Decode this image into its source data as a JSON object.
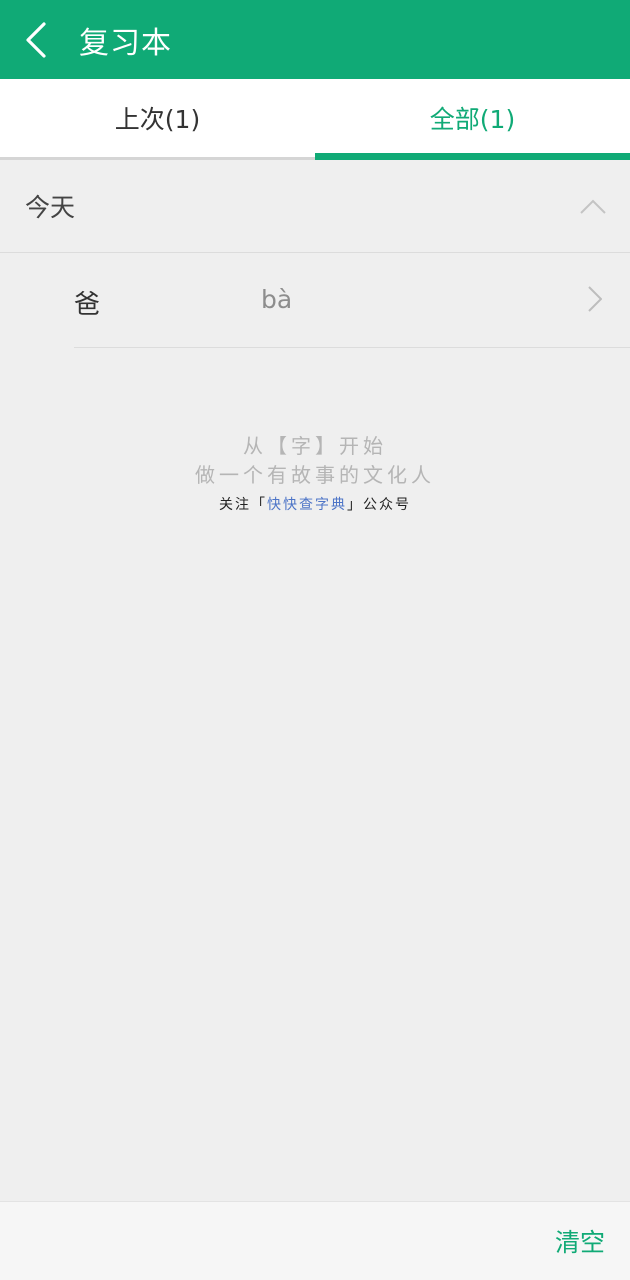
{
  "header": {
    "title": "复习本",
    "back_icon": "chevron-left-icon"
  },
  "tabs": [
    {
      "label": "上次(1)",
      "active": false
    },
    {
      "label": "全部(1)",
      "active": true
    }
  ],
  "section": {
    "title": "今天",
    "toggle_icon": "chevron-up-icon"
  },
  "words": [
    {
      "char": "爸",
      "pinyin": "bà",
      "icon": "chevron-right-icon"
    }
  ],
  "promo": {
    "line1": "从【字】开始",
    "line2": "做一个有故事的文化人",
    "follow_prefix": "关注「",
    "follow_link": "快快查字典",
    "follow_suffix": "」公众号"
  },
  "bottom": {
    "clear_label": "清空"
  },
  "colors": {
    "accent": "#10aa76",
    "link": "#4d74c7",
    "background": "#efefef"
  }
}
